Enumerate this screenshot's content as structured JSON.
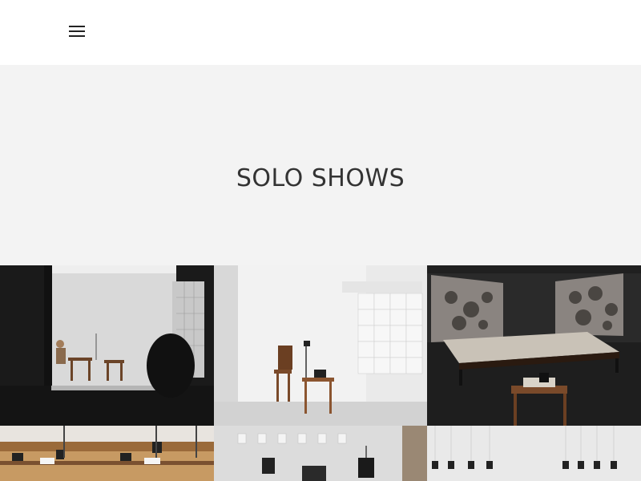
{
  "header": {
    "menu_icon": "hamburger-menu-icon"
  },
  "hero": {
    "title": "SOLO SHOWS"
  },
  "gallery": {
    "items": [
      {
        "image": "photo-window-view-performance"
      },
      {
        "image": "photo-white-room-chair-table"
      },
      {
        "image": "photo-dark-room-large-table"
      },
      {
        "image": "photo-tables-with-devices"
      },
      {
        "image": "photo-white-room-objects"
      },
      {
        "image": "photo-hanging-frames"
      }
    ]
  },
  "colors": {
    "hero_background": "#f3f3f3",
    "text": "#333333"
  }
}
